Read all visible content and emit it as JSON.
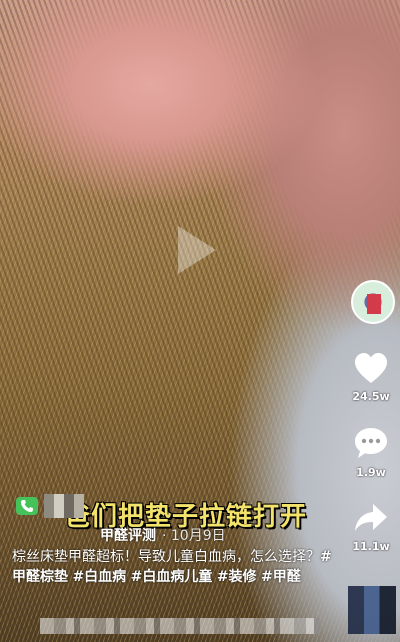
{
  "video": {
    "caption_overlay": "爸们把垫子拉链打开"
  },
  "author": {
    "name": "甲醛评测",
    "date": "· 10月9日"
  },
  "post": {
    "text": "棕丝床垫甲醛超标！导致儿童白血病，怎么选择？",
    "hashtags": [
      "#甲醛棕垫",
      "#白血病",
      "#白血病儿童",
      "#装修",
      "#甲醛"
    ]
  },
  "actions": {
    "like_count": "24.5w",
    "comment_count": "1.9w",
    "share_count": "11.1w"
  },
  "colors": {
    "caption": "#f3e36b",
    "badge": "#45c25a"
  },
  "icons": [
    "play-icon",
    "heart-icon",
    "comment-icon",
    "share-icon",
    "phone-icon"
  ]
}
